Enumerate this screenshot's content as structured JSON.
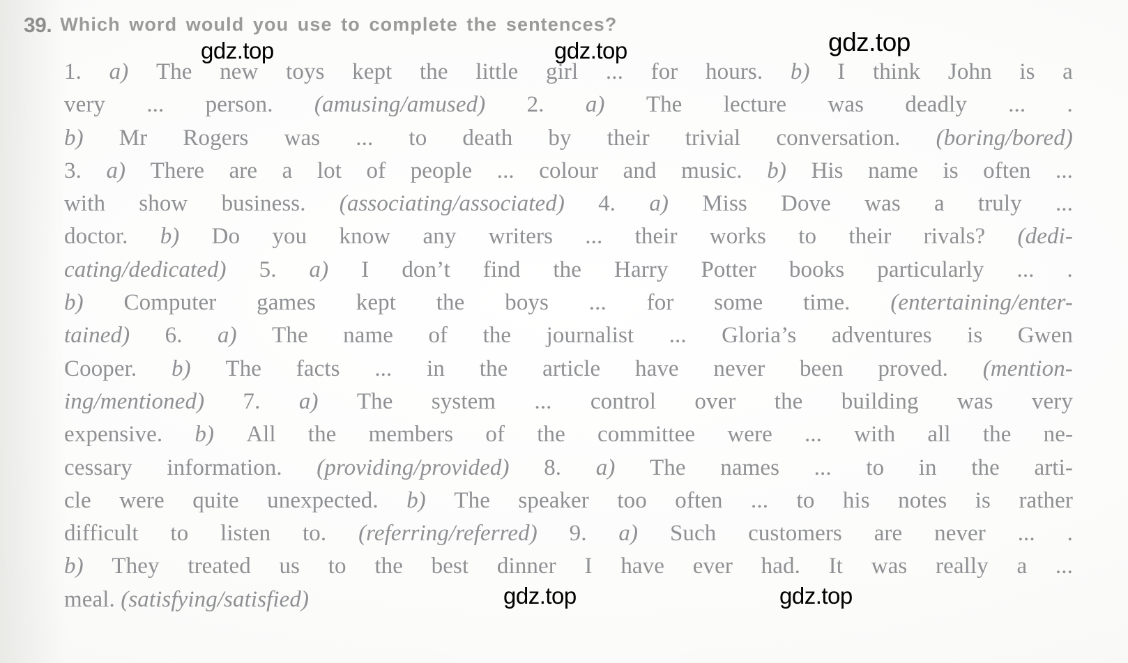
{
  "page": {
    "background_color": "#fdfdfc",
    "text_color": "#8f9093",
    "heading_color": "#9a9a9a",
    "watermark_color": "#000000"
  },
  "exercise": {
    "number": "39.",
    "heading": "Which word would you use to complete the sentences?",
    "lines": [
      "1. a) The new toys kept the little girl ... for hours. b) I think John is a",
      "very ... person. (amusing/amused) 2. a) The lecture was deadly ... .",
      "b) Mr Rogers was ... to death by their trivial conversation. (boring/bored)",
      "3. a) There are a lot of people ... colour and music. b) His name is often ...",
      "with show business. (associating/associated) 4. a) Miss Dove was a truly ...",
      "doctor. b) Do you know any writers ... their works to their rivals? (dedi-",
      "cating/dedicated) 5. a) I don’t find the Harry Potter books particularly ... .",
      "b) Computer games kept the boys ... for some time. (entertaining/enter-",
      "tained) 6. a) The name of the journalist ... Gloria’s adventures is Gwen",
      "Cooper. b) The facts ... in the article have never been proved. (mention-",
      "ing/mentioned) 7. a) The system ... control over the building was very",
      "expensive. b) All the members of the committee were ... with all the ne-",
      "cessary information. (providing/provided) 8. a) The names ... to in the arti-",
      "cle were quite unexpected. b) The speaker too often ... to his notes is rather",
      "difficult to listen to. (referring/referred) 9. a) Such customers are never ... .",
      "b) They treated us to the best dinner I have ever had. It was really a ...",
      "meal. (satisfying/satisfied)"
    ],
    "items": [
      {
        "number": "1.",
        "a": "The new toys kept the little girl ... for hours.",
        "b": "I think John is a very ... person.",
        "word_pair": "(amusing/amused)"
      },
      {
        "number": "2.",
        "a": "The lecture was deadly ... .",
        "b": "Mr Rogers was ... to death by their trivial conversation.",
        "word_pair": "(boring/bored)"
      },
      {
        "number": "3.",
        "a": "There are a lot of people ... colour and music.",
        "b": "His name is often ... with show business.",
        "word_pair": "(associating/associated)"
      },
      {
        "number": "4.",
        "a": "Miss Dove was a truly ... doctor.",
        "b": "Do you know any writers ... their works to their rivals?",
        "word_pair": "(dedicating/dedicated)"
      },
      {
        "number": "5.",
        "a": "I don’t find the Harry Potter books particularly ... .",
        "b": "Computer games kept the boys ... for some time.",
        "word_pair": "(entertaining/entertained)"
      },
      {
        "number": "6.",
        "a": "The name of the journalist ... Gloria’s adventures is Gwen Cooper.",
        "b": "The facts ... in the article have never been proved.",
        "word_pair": "(mentioning/mentioned)"
      },
      {
        "number": "7.",
        "a": "The system ... control over the building was very expensive.",
        "b": "All the members of the committee were ... with all the necessary information.",
        "word_pair": "(providing/provided)"
      },
      {
        "number": "8.",
        "a": "The names ... to in the article were quite unexpected.",
        "b": "The speaker too often ... to his notes is rather difficult to listen to.",
        "word_pair": "(referring/referred)"
      },
      {
        "number": "9.",
        "a": "Such customers are never ... .",
        "b": "They treated us to the best dinner I have ever had. It was really a ... meal.",
        "word_pair": "(satisfying/satisfied)"
      }
    ]
  },
  "watermarks": [
    {
      "text": "gdz.top"
    },
    {
      "text": "gdz.top"
    },
    {
      "text": "gdz.top"
    },
    {
      "text": "gdz.top"
    },
    {
      "text": "gdz.top"
    }
  ]
}
